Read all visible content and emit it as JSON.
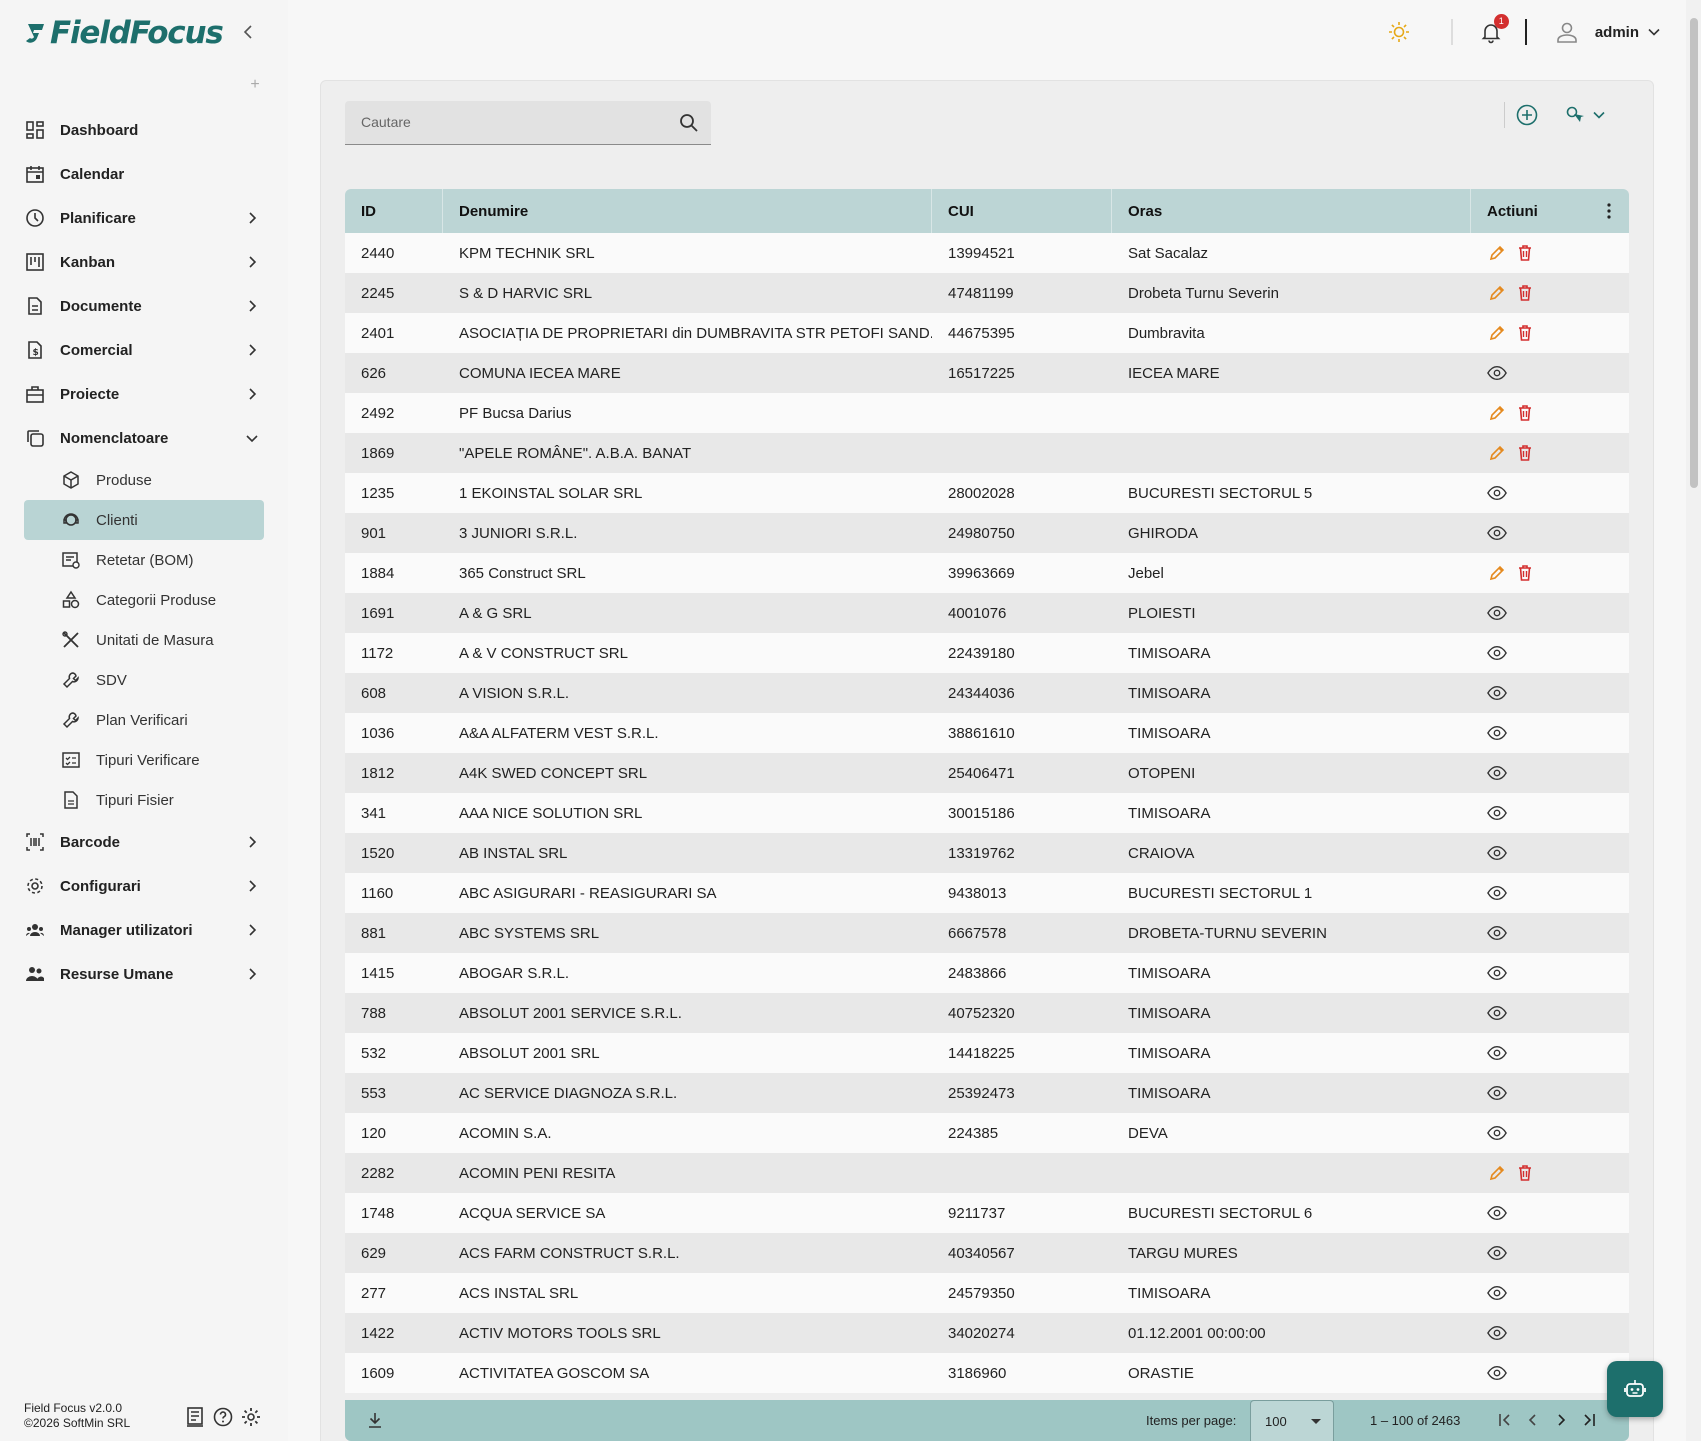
{
  "app": {
    "logo_text": "FieldFocus",
    "brand_color": "#1d6f6c",
    "accent_color": "#9ec6c4"
  },
  "topbar": {
    "notification_count": "1",
    "username": "admin",
    "icons": [
      "sun-icon",
      "bell-icon",
      "user-icon",
      "chevron-down-icon"
    ]
  },
  "sidebar": {
    "items": [
      {
        "label": "Dashboard",
        "icon": "dashboard-icon"
      },
      {
        "label": "Calendar",
        "icon": "calendar-icon"
      },
      {
        "label": "Planificare",
        "icon": "clock-icon"
      },
      {
        "label": "Kanban",
        "icon": "kanban-icon"
      },
      {
        "label": "Documente",
        "icon": "document-icon"
      },
      {
        "label": "Comercial",
        "icon": "invoice-icon"
      },
      {
        "label": "Proiecte",
        "icon": "briefcase-icon"
      },
      {
        "label": "Nomenclatoare",
        "icon": "copy-icon"
      }
    ],
    "subitems": [
      {
        "label": "Produse",
        "icon": "box-icon"
      },
      {
        "label": "Clienti",
        "icon": "support-agent-icon",
        "active": true
      },
      {
        "label": "Retetar (BOM)",
        "icon": "recipe-icon"
      },
      {
        "label": "Categorii Produse",
        "icon": "category-icon"
      },
      {
        "label": "Unitati de Masura",
        "icon": "tools-icon"
      },
      {
        "label": "SDV",
        "icon": "wrench-icon"
      },
      {
        "label": "Plan Verificari",
        "icon": "wrench-icon"
      },
      {
        "label": "Tipuri Verificare",
        "icon": "checklist-icon"
      },
      {
        "label": "Tipuri Fisier",
        "icon": "file-icon"
      }
    ],
    "items_after": [
      {
        "label": "Barcode",
        "icon": "barcode-icon"
      },
      {
        "label": "Configurari",
        "icon": "gear-icon"
      },
      {
        "label": "Manager utilizatori",
        "icon": "users-icon"
      },
      {
        "label": "Resurse Umane",
        "icon": "group-icon"
      }
    ],
    "footer": {
      "version": "Field Focus v2.0.0",
      "copyright": "©2026 SoftMin SRL"
    }
  },
  "search": {
    "placeholder": "Cautare"
  },
  "table": {
    "columns": [
      "ID",
      "Denumire",
      "CUI",
      "Oras",
      "Actiuni"
    ],
    "rows": [
      {
        "id": "2440",
        "name": "KPM TECHNIK SRL",
        "cui": "13994521",
        "city": "Sat Sacalaz",
        "actions": "edit"
      },
      {
        "id": "2245",
        "name": "S & D HARVIC SRL",
        "cui": "47481199",
        "city": "Drobeta Turnu Severin",
        "actions": "edit"
      },
      {
        "id": "2401",
        "name": "ASOCIAȚIA DE PROPRIETARI din DUMBRAVITA STR PETOFI SAND...",
        "cui": "44675395",
        "city": "Dumbravita",
        "actions": "edit"
      },
      {
        "id": "626",
        "name": "COMUNA IECEA MARE",
        "cui": "16517225",
        "city": "IECEA MARE",
        "actions": "view"
      },
      {
        "id": "2492",
        "name": "PF Bucsa Darius",
        "cui": "",
        "city": "",
        "actions": "edit"
      },
      {
        "id": "1869",
        "name": "\"APELE ROMÂNE\". A.B.A. BANAT",
        "cui": "",
        "city": "",
        "actions": "edit"
      },
      {
        "id": "1235",
        "name": "1 EKOINSTAL SOLAR SRL",
        "cui": "28002028",
        "city": "BUCURESTI SECTORUL 5",
        "actions": "view"
      },
      {
        "id": "901",
        "name": "3 JUNIORI S.R.L.",
        "cui": "24980750",
        "city": "GHIRODA",
        "actions": "view"
      },
      {
        "id": "1884",
        "name": "365 Construct SRL",
        "cui": "39963669",
        "city": "Jebel",
        "actions": "edit"
      },
      {
        "id": "1691",
        "name": "A & G SRL",
        "cui": "4001076",
        "city": "PLOIESTI",
        "actions": "view"
      },
      {
        "id": "1172",
        "name": "A & V CONSTRUCT SRL",
        "cui": "22439180",
        "city": "TIMISOARA",
        "actions": "view"
      },
      {
        "id": "608",
        "name": "A VISION S.R.L.",
        "cui": "24344036",
        "city": "TIMISOARA",
        "actions": "view"
      },
      {
        "id": "1036",
        "name": "A&A ALFATERM VEST S.R.L.",
        "cui": "38861610",
        "city": "TIMISOARA",
        "actions": "view"
      },
      {
        "id": "1812",
        "name": "A4K SWED CONCEPT SRL",
        "cui": "25406471",
        "city": "OTOPENI",
        "actions": "view"
      },
      {
        "id": "341",
        "name": "AAA NICE SOLUTION SRL",
        "cui": "30015186",
        "city": "TIMISOARA",
        "actions": "view"
      },
      {
        "id": "1520",
        "name": "AB INSTAL SRL",
        "cui": "13319762",
        "city": "CRAIOVA",
        "actions": "view"
      },
      {
        "id": "1160",
        "name": "ABC ASIGURARI - REASIGURARI SA",
        "cui": "9438013",
        "city": "BUCURESTI SECTORUL 1",
        "actions": "view"
      },
      {
        "id": "881",
        "name": "ABC SYSTEMS SRL",
        "cui": "6667578",
        "city": "DROBETA-TURNU SEVERIN",
        "actions": "view"
      },
      {
        "id": "1415",
        "name": "ABOGAR S.R.L.",
        "cui": "2483866",
        "city": "TIMISOARA",
        "actions": "view"
      },
      {
        "id": "788",
        "name": "ABSOLUT 2001 SERVICE S.R.L.",
        "cui": "40752320",
        "city": "TIMISOARA",
        "actions": "view"
      },
      {
        "id": "532",
        "name": "ABSOLUT 2001 SRL",
        "cui": "14418225",
        "city": "TIMISOARA",
        "actions": "view"
      },
      {
        "id": "553",
        "name": "AC SERVICE DIAGNOZA S.R.L.",
        "cui": "25392473",
        "city": "TIMISOARA",
        "actions": "view"
      },
      {
        "id": "120",
        "name": "ACOMIN S.A.",
        "cui": "224385",
        "city": "DEVA",
        "actions": "view"
      },
      {
        "id": "2282",
        "name": "ACOMIN PENI RESITA",
        "cui": "",
        "city": "",
        "actions": "edit"
      },
      {
        "id": "1748",
        "name": "ACQUA SERVICE SA",
        "cui": "9211737",
        "city": "BUCURESTI SECTORUL 6",
        "actions": "view"
      },
      {
        "id": "629",
        "name": "ACS FARM CONSTRUCT S.R.L.",
        "cui": "40340567",
        "city": "TARGU MURES",
        "actions": "view"
      },
      {
        "id": "277",
        "name": "ACS INSTAL SRL",
        "cui": "24579350",
        "city": "TIMISOARA",
        "actions": "view"
      },
      {
        "id": "1422",
        "name": "ACTIV MOTORS TOOLS SRL",
        "cui": "34020274",
        "city": "01.12.2001 00:00:00",
        "actions": "view"
      },
      {
        "id": "1609",
        "name": "ACTIVITATEA GOSCOM SA",
        "cui": "3186960",
        "city": "ORASTIE",
        "actions": "view"
      }
    ]
  },
  "paginator": {
    "items_per_page_label": "Items per page:",
    "page_size": "100",
    "range_label": "1 – 100 of 2463"
  }
}
